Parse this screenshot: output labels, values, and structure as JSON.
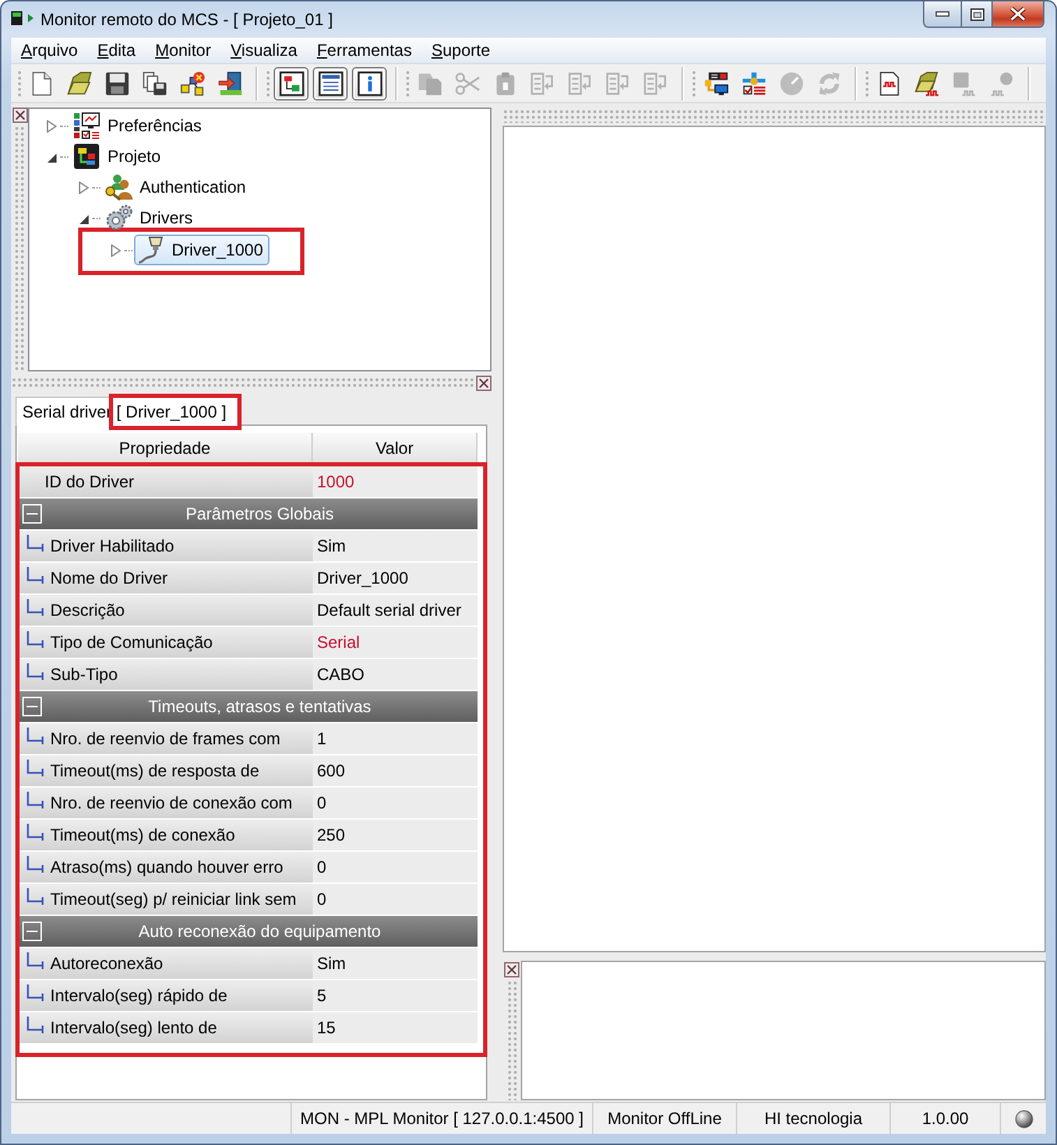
{
  "window": {
    "title": "Monitor remoto do MCS - [ Projeto_01 ]"
  },
  "menu": [
    "Arquivo",
    "Edita",
    "Monitor",
    "Visualiza",
    "Ferramentas",
    "Suporte"
  ],
  "toolbar": {
    "groups": [
      {
        "items": [
          {
            "pressed": false,
            "disabled": false
          },
          {
            "pressed": false,
            "disabled": false
          },
          {
            "pressed": false,
            "disabled": false
          },
          {
            "pressed": false,
            "disabled": false
          },
          {
            "pressed": false,
            "disabled": false
          },
          {
            "pressed": false,
            "disabled": false
          }
        ]
      },
      {
        "items": [
          {
            "pressed": true,
            "disabled": false
          },
          {
            "pressed": true,
            "disabled": false
          },
          {
            "pressed": true,
            "disabled": false
          }
        ]
      },
      {
        "items": [
          {
            "pressed": false,
            "disabled": true
          },
          {
            "pressed": false,
            "disabled": true
          },
          {
            "pressed": false,
            "disabled": true
          },
          {
            "pressed": false,
            "disabled": true
          },
          {
            "pressed": false,
            "disabled": true
          },
          {
            "pressed": false,
            "disabled": true
          },
          {
            "pressed": false,
            "disabled": true
          }
        ]
      },
      {
        "items": [
          {
            "pressed": false,
            "disabled": false
          },
          {
            "pressed": false,
            "disabled": false
          },
          {
            "pressed": false,
            "disabled": true
          },
          {
            "pressed": false,
            "disabled": true
          }
        ]
      },
      {
        "items": [
          {
            "pressed": false,
            "disabled": false
          },
          {
            "pressed": false,
            "disabled": false
          },
          {
            "pressed": false,
            "disabled": true
          },
          {
            "pressed": false,
            "disabled": true
          }
        ]
      }
    ]
  },
  "tree": {
    "items": [
      {
        "label": "Preferências",
        "kind": "settings",
        "expanded": false,
        "selected": false,
        "annotated": false
      },
      {
        "label": "Projeto",
        "kind": "project",
        "expanded": true,
        "selected": false,
        "annotated": false,
        "children": [
          {
            "label": "Authentication",
            "kind": "users",
            "expanded": false,
            "selected": false,
            "annotated": false
          },
          {
            "label": "Drivers",
            "kind": "drivers",
            "expanded": true,
            "selected": false,
            "annotated": false,
            "children": [
              {
                "label": "Driver_1000",
                "kind": "driver",
                "expanded": false,
                "selected": true,
                "annotated": true
              }
            ]
          }
        ]
      }
    ]
  },
  "properties": {
    "tab": {
      "label": "Serial driver",
      "title": "[ Driver_1000 ]",
      "selected": true,
      "title_annotated": true
    },
    "columns": [
      "Propriedade",
      "Valor"
    ],
    "annotated": true,
    "rows": [
      {
        "kind": "property",
        "name": "ID do Driver",
        "value": "1000",
        "color": "#c8102e"
      },
      {
        "kind": "group",
        "label": "Parâmetros Globais",
        "expanded": true,
        "children": [
          {
            "name": "Driver Habilitado",
            "value": "Sim",
            "color": "#000000"
          },
          {
            "name": "Nome do Driver",
            "value": "Driver_1000",
            "color": "#000000"
          },
          {
            "name": "Descrição",
            "value": "Default serial driver",
            "color": "#000000"
          },
          {
            "name": "Tipo de Comunicação",
            "value": "Serial",
            "color": "#c8102e"
          },
          {
            "name": "Sub-Tipo",
            "value": "CABO",
            "color": "#000000"
          }
        ]
      },
      {
        "kind": "group",
        "label": "Timeouts, atrasos e tentativas",
        "expanded": true,
        "children": [
          {
            "name": "Nro. de reenvio de frames com",
            "value": "1",
            "color": "#000000"
          },
          {
            "name": "Timeout(ms) de resposta de",
            "value": "600",
            "color": "#000000"
          },
          {
            "name": "Nro. de reenvio de conexão com",
            "value": "0",
            "color": "#000000"
          },
          {
            "name": "Timeout(ms) de conexão",
            "value": "250",
            "color": "#000000"
          },
          {
            "name": "Atraso(ms) quando houver erro",
            "value": "0",
            "color": "#000000"
          },
          {
            "name": "Timeout(seg) p/ reiniciar link sem",
            "value": "0",
            "color": "#000000"
          }
        ]
      },
      {
        "kind": "group",
        "label": "Auto reconexão do equipamento",
        "expanded": true,
        "children": [
          {
            "name": "Autoreconexão",
            "value": "Sim",
            "color": "#000000"
          },
          {
            "name": "Intervalo(seg) rápido de",
            "value": "5",
            "color": "#000000"
          },
          {
            "name": "Intervalo(seg) lento de",
            "value": "15",
            "color": "#000000"
          }
        ]
      }
    ]
  },
  "status_bar": {
    "sections": [
      "MON - MPL Monitor [ 127.0.0.1:4500 ]",
      "Monitor OffLine",
      "HI tecnologia",
      "1.0.00"
    ]
  }
}
